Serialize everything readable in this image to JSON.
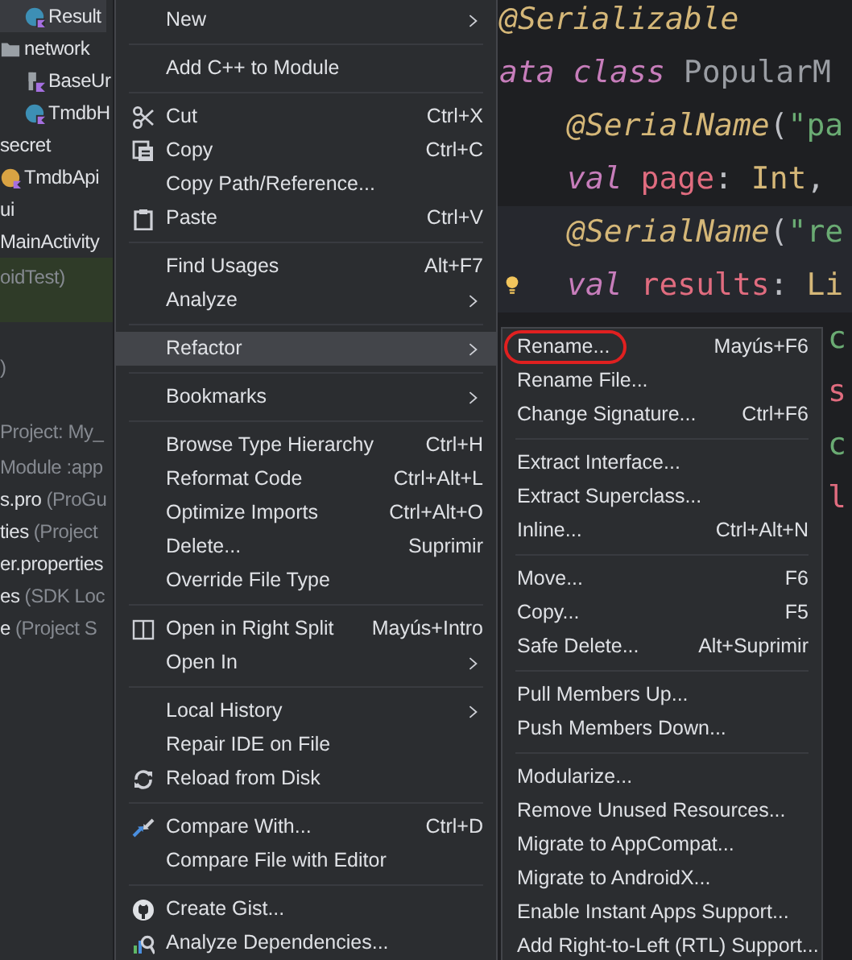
{
  "project_tree": [
    {
      "children": [
        {
          "children": [
            {
              "name": "Result",
              "kind": "class",
              "selected": true
            }
          ]
        },
        {
          "name": "network",
          "kind": "folder",
          "children": [
            {
              "name": "BaseUr",
              "kind": "file"
            },
            {
              "name": "TmdbH",
              "kind": "class"
            }
          ]
        }
      ]
    },
    {
      "name": "secret",
      "children": [
        {
          "name": "TmdbApi",
          "kind": "object"
        }
      ]
    },
    {
      "name": "ui"
    },
    {
      "name": "MainActivity"
    },
    {
      "detail": "oidTest)",
      "tinted": true
    },
    {
      "detail": ")",
      "spaced": true
    },
    {
      "detail": "Project: My_",
      "spaced": true
    },
    {
      "detail": "Module :app"
    },
    {
      "name": "s.pro",
      "detail": "(ProGu"
    },
    {
      "name": "ties",
      "detail": "(Project"
    },
    {
      "name": "er.properties"
    },
    {
      "name": "es",
      "detail": "(SDK Loc"
    },
    {
      "name": "e",
      "detail": "(Project S"
    }
  ],
  "code": {
    "lines": [
      {
        "segments": [
          {
            "text": "@Serializable",
            "kind": "annotation"
          }
        ]
      },
      {
        "segments": [
          {
            "text": "ata class",
            "kind": "keyword"
          },
          {
            "text": " PopularM",
            "kind": "plain"
          }
        ]
      },
      {
        "indented": true,
        "segments": [
          {
            "text": "@SerialName",
            "kind": "annotation"
          },
          {
            "text": "(",
            "kind": "punct"
          },
          {
            "text": "\"pa",
            "kind": "string"
          }
        ]
      },
      {
        "indented": true,
        "segments": [
          {
            "text": "val",
            "kind": "keyword"
          },
          {
            "text": " page",
            "kind": "property"
          },
          {
            "text": ": ",
            "kind": "punct"
          },
          {
            "text": "Int",
            "kind": "type"
          },
          {
            "text": ",",
            "kind": "punct"
          }
        ]
      },
      {
        "indented": true,
        "highlighted": true,
        "segments": [
          {
            "text": "@SerialName",
            "kind": "annotation"
          },
          {
            "text": "(",
            "kind": "punct"
          },
          {
            "text": "\"re",
            "kind": "string"
          }
        ]
      },
      {
        "indented": true,
        "highlighted": true,
        "lightbulb": true,
        "segments": [
          {
            "text": "val",
            "kind": "keyword"
          },
          {
            "text": " results",
            "kind": "property"
          },
          {
            "text": ": ",
            "kind": "punct"
          },
          {
            "text": "Li",
            "kind": "type"
          }
        ]
      },
      {
        "clipped": true,
        "segments": [
          {
            "text": "c",
            "kind": "string"
          }
        ]
      },
      {
        "clipped": true,
        "segments": [
          {
            "text": "s",
            "kind": "property"
          }
        ]
      },
      {
        "clipped": true,
        "segments": [
          {
            "text": "c",
            "kind": "string"
          }
        ]
      },
      {
        "clipped": true,
        "segments": [
          {
            "text": "l",
            "kind": "property"
          }
        ]
      }
    ]
  },
  "context_menu": {
    "items": [
      {
        "kind": "item",
        "label": "New",
        "submenu": true,
        "selected": false
      },
      {
        "kind": "separator"
      },
      {
        "kind": "item",
        "label": "Add C++ to Module",
        "selected": false
      },
      {
        "kind": "separator"
      },
      {
        "kind": "cut",
        "label": "Cut",
        "shortcut": "Ctrl+X",
        "selected": false
      },
      {
        "kind": "copy",
        "label": "Copy",
        "shortcut": "Ctrl+C",
        "selected": false
      },
      {
        "kind": "item",
        "label": "Copy Path/Reference...",
        "selected": false
      },
      {
        "kind": "paste",
        "label": "Paste",
        "shortcut": "Ctrl+V",
        "selected": false
      },
      {
        "kind": "separator"
      },
      {
        "kind": "item",
        "label": "Find Usages",
        "shortcut": "Alt+F7",
        "selected": false
      },
      {
        "kind": "item",
        "label": "Analyze",
        "submenu": true,
        "selected": false
      },
      {
        "kind": "separator"
      },
      {
        "kind": "item",
        "label": "Refactor",
        "submenu": true,
        "selected": true
      },
      {
        "kind": "separator"
      },
      {
        "kind": "item",
        "label": "Bookmarks",
        "submenu": true,
        "selected": false
      },
      {
        "kind": "separator"
      },
      {
        "kind": "item",
        "label": "Browse Type Hierarchy",
        "shortcut": "Ctrl+H",
        "selected": false
      },
      {
        "kind": "item",
        "label": "Reformat Code",
        "shortcut": "Ctrl+Alt+L",
        "selected": false
      },
      {
        "kind": "item",
        "label": "Optimize Imports",
        "shortcut": "Ctrl+Alt+O",
        "selected": false
      },
      {
        "kind": "item",
        "label": "Delete...",
        "shortcut": "Suprimir",
        "selected": false
      },
      {
        "kind": "item",
        "label": "Override File Type",
        "selected": false
      },
      {
        "kind": "separator"
      },
      {
        "kind": "split",
        "label": "Open in Right Split",
        "shortcut": "Mayús+Intro",
        "selected": false
      },
      {
        "kind": "item",
        "label": "Open In",
        "submenu": true,
        "selected": false
      },
      {
        "kind": "separator"
      },
      {
        "kind": "item",
        "label": "Local History",
        "submenu": true,
        "selected": false
      },
      {
        "kind": "item",
        "label": "Repair IDE on File",
        "selected": false
      },
      {
        "kind": "reload",
        "label": "Reload from Disk",
        "selected": false
      },
      {
        "kind": "separator"
      },
      {
        "kind": "compare",
        "label": "Compare With...",
        "shortcut": "Ctrl+D",
        "selected": false
      },
      {
        "kind": "item",
        "label": "Compare File with Editor",
        "selected": false
      },
      {
        "kind": "separator"
      },
      {
        "kind": "github",
        "label": "Create Gist...",
        "selected": false
      },
      {
        "kind": "analyze",
        "label": "Analyze Dependencies...",
        "selected": false
      }
    ]
  },
  "refactor_submenu": {
    "items": [
      {
        "kind": "item",
        "label": "Rename...",
        "shortcut": "Mayús+F6",
        "circled": true,
        "selected": false
      },
      {
        "kind": "item",
        "label": "Rename File...",
        "selected": false
      },
      {
        "kind": "item",
        "label": "Change Signature...",
        "shortcut": "Ctrl+F6",
        "selected": false
      },
      {
        "kind": "separator"
      },
      {
        "kind": "item",
        "label": "Extract Interface...",
        "selected": false
      },
      {
        "kind": "item",
        "label": "Extract Superclass...",
        "selected": false
      },
      {
        "kind": "item",
        "label": "Inline...",
        "shortcut": "Ctrl+Alt+N",
        "selected": false
      },
      {
        "kind": "separator"
      },
      {
        "kind": "item",
        "label": "Move...",
        "shortcut": "F6",
        "selected": false
      },
      {
        "kind": "item",
        "label": "Copy...",
        "shortcut": "F5",
        "selected": false
      },
      {
        "kind": "item",
        "label": "Safe Delete...",
        "shortcut": "Alt+Suprimir",
        "selected": false
      },
      {
        "kind": "separator"
      },
      {
        "kind": "item",
        "label": "Pull Members Up...",
        "selected": false
      },
      {
        "kind": "item",
        "label": "Push Members Down...",
        "selected": false
      },
      {
        "kind": "separator"
      },
      {
        "kind": "item",
        "label": "Modularize...",
        "selected": false
      },
      {
        "kind": "item",
        "label": "Remove Unused Resources...",
        "selected": false
      },
      {
        "kind": "item",
        "label": "Migrate to AppCompat...",
        "selected": false
      },
      {
        "kind": "item",
        "label": "Migrate to AndroidX...",
        "selected": false
      },
      {
        "kind": "item",
        "label": "Enable Instant Apps Support...",
        "selected": false
      },
      {
        "kind": "item",
        "label": "Add Right-to-Left (RTL) Support...",
        "selected": false
      }
    ]
  }
}
